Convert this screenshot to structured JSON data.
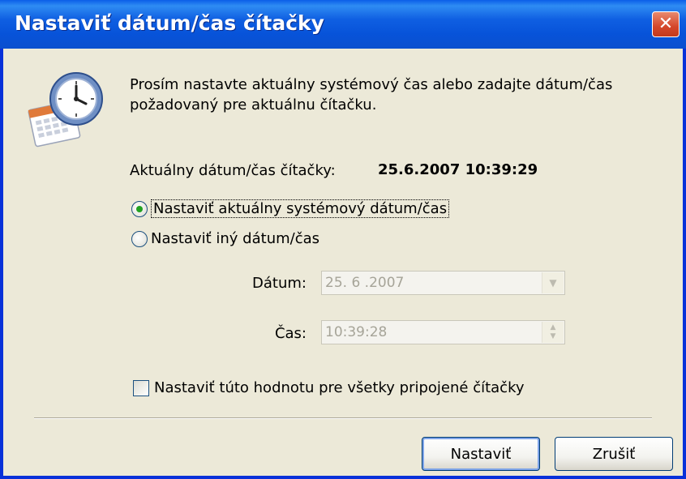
{
  "window": {
    "title": "Nastaviť dátum/čas čítačky",
    "close_glyph": "✕"
  },
  "icon": "clock-calendar-icon",
  "instructions": "Prosím nastavte aktuálny systémový čas alebo zadajte dátum/čas požadovaný pre aktuálnu čítačku.",
  "current": {
    "label": "Aktuálny dátum/čas čítačky:",
    "value": "25.6.2007 10:39:29"
  },
  "options": {
    "system": {
      "label": "Nastaviť aktuálny systémový dátum/čas",
      "checked": true
    },
    "custom": {
      "label": "Nastaviť iný dátum/čas",
      "checked": false
    }
  },
  "date": {
    "label": "Dátum:",
    "value": "25.  6 .2007",
    "enabled": false
  },
  "time": {
    "label": "Čas:",
    "value": "10:39:28",
    "enabled": false
  },
  "apply_all": {
    "label": "Nastaviť túto hodnotu pre všetky pripojené čítačky",
    "checked": false
  },
  "buttons": {
    "ok": "Nastaviť",
    "cancel": "Zrušiť"
  },
  "colors": {
    "titlebar": "#0753d9",
    "dialog_bg": "#ece9d8",
    "close_button": "#d5472a",
    "radio_dot": "#21a121"
  }
}
